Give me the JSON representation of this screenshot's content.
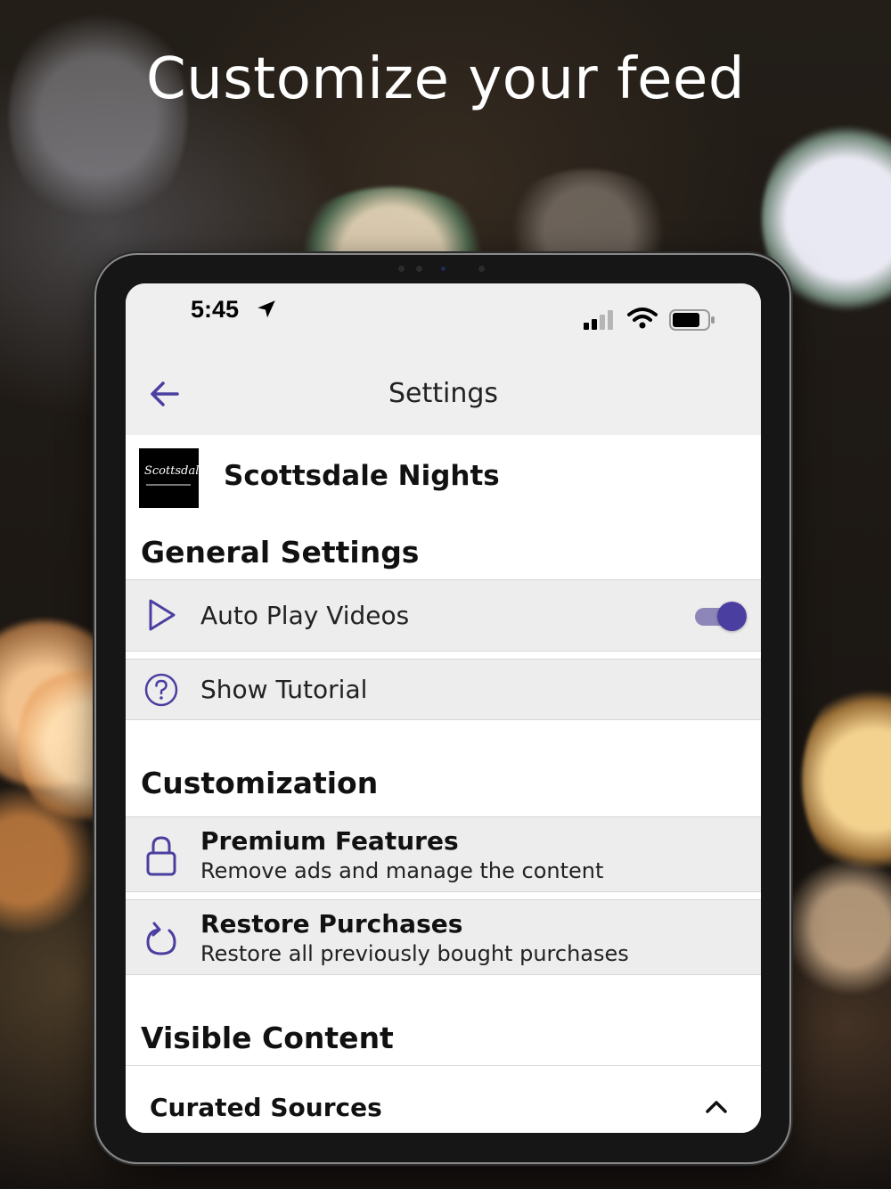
{
  "headline": "Customize your feed",
  "status_bar": {
    "time": "5:45",
    "icons": [
      "location-arrow-icon",
      "cellular-signal-icon",
      "wifi-icon",
      "battery-icon"
    ]
  },
  "nav": {
    "title": "Settings",
    "back_icon": "arrow-left-icon"
  },
  "app": {
    "name": "Scottsdale Nights",
    "logo_text": "Scottsdale"
  },
  "sections": {
    "general": {
      "title": "General Settings",
      "items": [
        {
          "label": "Auto Play Videos",
          "icon": "play-icon",
          "toggle_on": true
        },
        {
          "label": "Show Tutorial",
          "icon": "question-circle-icon"
        }
      ]
    },
    "customization": {
      "title": "Customization",
      "items": [
        {
          "title": "Premium Features",
          "subtitle": "Remove ads and manage the content",
          "icon": "lock-icon"
        },
        {
          "title": "Restore Purchases",
          "subtitle": "Restore all previously bought purchases",
          "icon": "refresh-icon"
        }
      ]
    },
    "visible": {
      "title": "Visible Content",
      "items": [
        {
          "label": "Curated Sources",
          "icon": "chevron-up-icon"
        }
      ]
    }
  },
  "colors": {
    "accent": "#4a3fa0",
    "toggle_track": "#8d87b9",
    "row_background": "#ededed",
    "nav_background": "#efefef"
  }
}
